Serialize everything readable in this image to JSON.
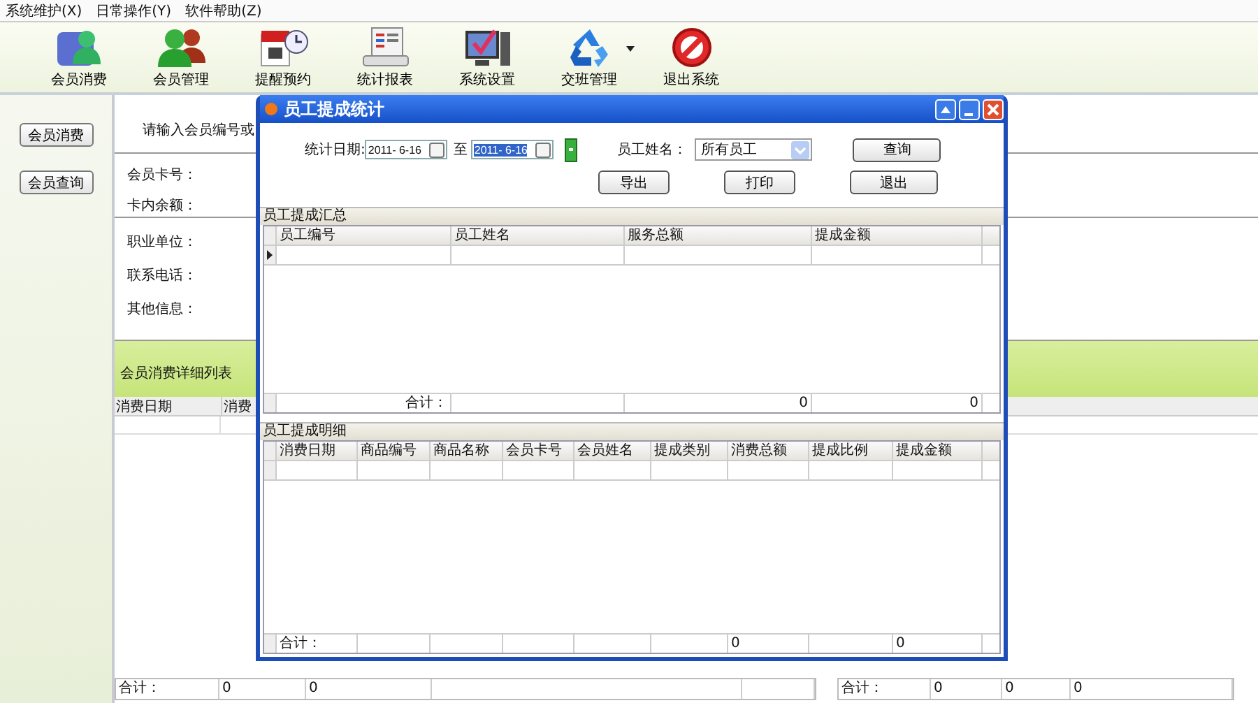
{
  "menu": [
    {
      "label": "系统维护(X)"
    },
    {
      "label": "日常操作(Y)"
    },
    {
      "label": "软件帮助(Z)"
    }
  ],
  "toolbar": [
    {
      "label": "会员消费",
      "kind": "member"
    },
    {
      "label": "会员管理",
      "kind": "members"
    },
    {
      "label": "提醒预约",
      "kind": "calendar"
    },
    {
      "label": "统计报表",
      "kind": "report"
    },
    {
      "label": "系统设置",
      "kind": "settings"
    },
    {
      "label": "交班管理",
      "kind": "recycle",
      "dropdown": true
    },
    {
      "label": "退出系统",
      "kind": "exit"
    }
  ],
  "sidebar": {
    "buttons": [
      "会员消费",
      "会员查询"
    ]
  },
  "member_panel": {
    "prompt": "请输入会员编号或",
    "card_fields": [
      "会员卡号：",
      "卡内余额："
    ],
    "info_fields": [
      "职业单位：",
      "联系电话：",
      "其他信息："
    ],
    "list_title": "会员消费详细列表",
    "list_columns": [
      "消费日期",
      "消费"
    ],
    "left_totals": [
      "合计：",
      "0",
      "0"
    ],
    "right_totals": [
      "合计：",
      "0",
      "0",
      "0"
    ]
  },
  "dialog": {
    "title": "员工提成统计",
    "date_label": "统计日期:",
    "date_from": {
      "value": "2011- 6-16",
      "selected": false
    },
    "date_sep": "至",
    "date_to": {
      "value": "2011- 6-16",
      "selected": true
    },
    "staff_label": "员工姓名：",
    "staff_value": "所有员工",
    "buttons": [
      {
        "label": "查询"
      },
      {
        "label": "导出"
      },
      {
        "label": "打印"
      },
      {
        "label": "退出"
      }
    ],
    "summary": {
      "title": "员工提成汇总",
      "columns": [
        {
          "label": "员工编号",
          "total": "合计："
        },
        {
          "label": "员工姓名"
        },
        {
          "label": "服务总额",
          "total": "0"
        },
        {
          "label": "提成金额",
          "total": "0"
        }
      ]
    },
    "detail": {
      "title": "员工提成明细",
      "columns": [
        {
          "label": "消费日期",
          "total": "合计："
        },
        {
          "label": "商品编号"
        },
        {
          "label": "商品名称"
        },
        {
          "label": "会员卡号"
        },
        {
          "label": "会员姓名"
        },
        {
          "label": "提成类别"
        },
        {
          "label": "消费总额",
          "total": "0"
        },
        {
          "label": "提成比例"
        },
        {
          "label": "提成金额",
          "total": "0"
        }
      ]
    }
  }
}
